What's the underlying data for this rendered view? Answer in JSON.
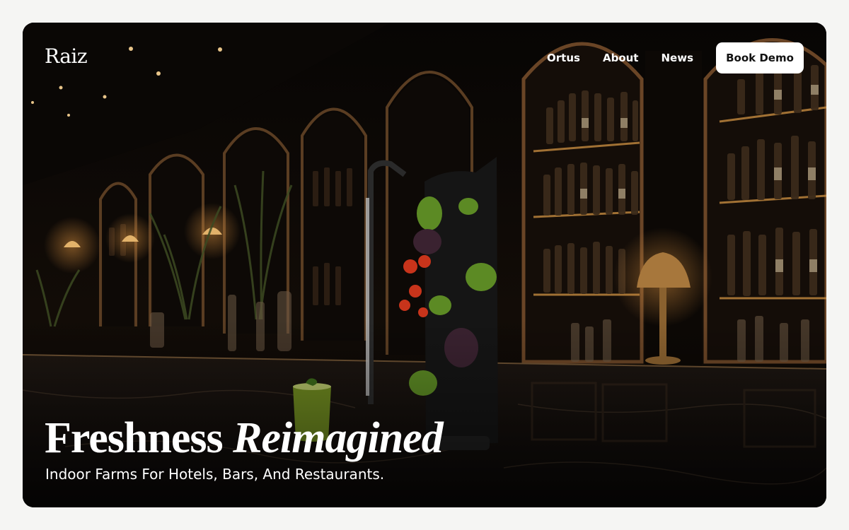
{
  "brand": {
    "logo_text": "Raiz"
  },
  "nav": {
    "links": [
      {
        "label": "Ortus"
      },
      {
        "label": "About"
      },
      {
        "label": "News"
      }
    ],
    "cta_label": "Book Demo"
  },
  "hero": {
    "title_regular": "Freshness",
    "title_italic": "Reimagined",
    "subtitle": "Indoor Farms For Hotels, Bars, And Restaurants.",
    "image_subject": "dark upscale bar with bottle shelves, arched alcoves, brass lamps and a vertical indoor herb farm on a marble counter"
  },
  "colors": {
    "page_background": "#f5f5f3",
    "hero_background": "#0b0806",
    "text_on_hero": "#ffffff",
    "button_background": "#ffffff",
    "button_text": "#111111",
    "accent_brass": "#c58a3f"
  }
}
